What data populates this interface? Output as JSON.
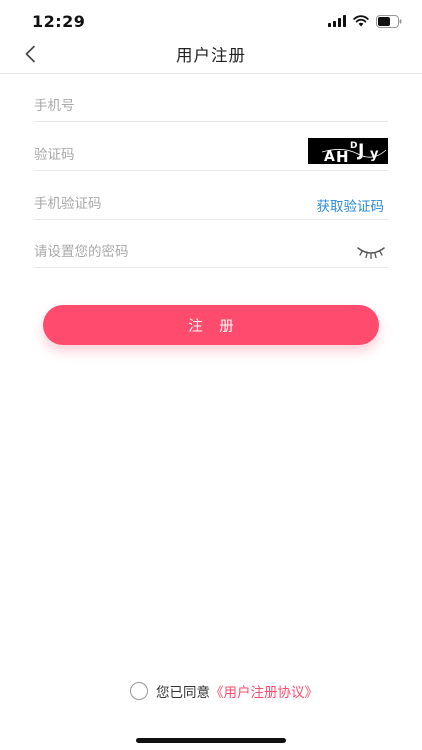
{
  "status_bar": {
    "time": "12:29"
  },
  "nav": {
    "title": "用户注册",
    "back_icon": "chevron-left-icon"
  },
  "form": {
    "phone_placeholder": "手机号",
    "captcha_placeholder": "验证码",
    "captcha_image_text": "AHDJY",
    "sms_code_placeholder": "手机验证码",
    "get_code_label": "获取验证码",
    "password_placeholder": "请设置您的密码",
    "password_toggle_icon": "eye-closed-icon"
  },
  "register_button": {
    "label": "注 册"
  },
  "agreement": {
    "prefix": "您已同意",
    "link": "《用户注册协议》",
    "checked": false
  },
  "colors": {
    "accent": "#ff4b6e",
    "link_blue": "#2a8bd6",
    "placeholder": "#a8a8a8",
    "divider": "#e8e8e8"
  }
}
